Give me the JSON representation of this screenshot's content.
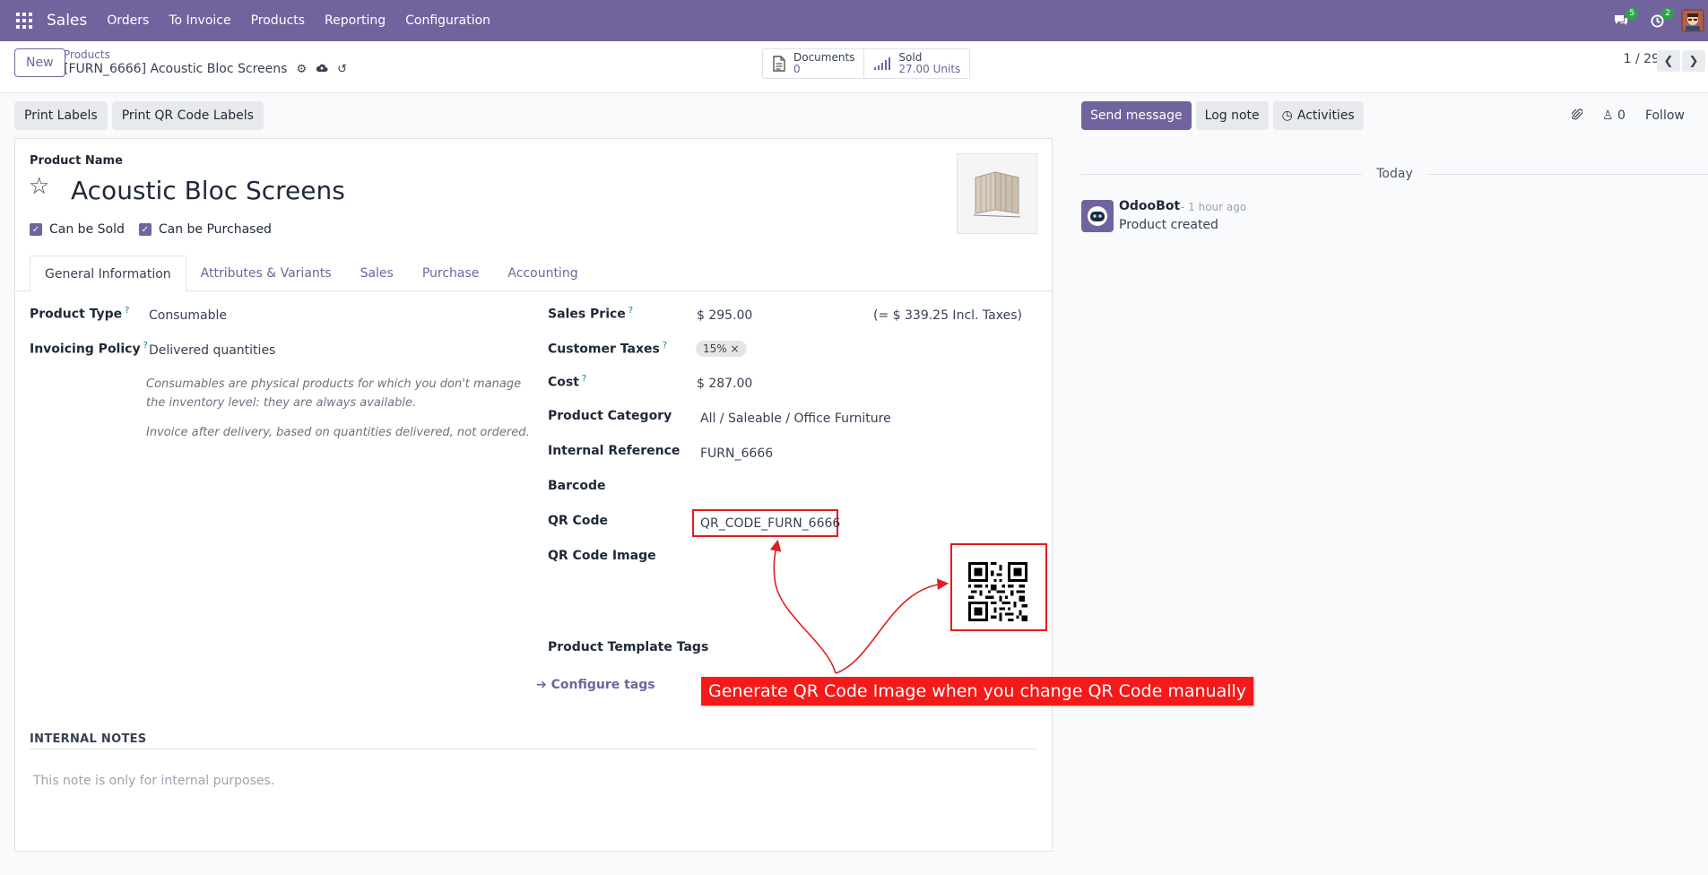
{
  "navbar": {
    "app_name": "Sales",
    "menu": [
      "Orders",
      "To Invoice",
      "Products",
      "Reporting",
      "Configuration"
    ],
    "messages_badge": "5",
    "activities_badge": "2"
  },
  "control_panel": {
    "new_label": "New",
    "breadcrumb_parent": "Products",
    "breadcrumb_current": "[FURN_6666] Acoustic Bloc Screens",
    "smart_buttons": {
      "documents_label": "Documents",
      "documents_value": "0",
      "sold_label": "Sold",
      "sold_value": "27.00 Units"
    },
    "pager": "1 / 29"
  },
  "actions": {
    "print_labels": "Print Labels",
    "print_qr_labels": "Print QR Code Labels"
  },
  "form": {
    "product_name_label": "Product Name",
    "product_name": "Acoustic Bloc Screens",
    "can_be_sold": "Can be Sold",
    "can_be_purchased": "Can be Purchased",
    "tabs": [
      "General Information",
      "Attributes & Variants",
      "Sales",
      "Purchase",
      "Accounting"
    ],
    "product_type_label": "Product Type",
    "product_type": "Consumable",
    "invoicing_policy_label": "Invoicing Policy",
    "invoicing_policy": "Delivered quantities",
    "help_consumable": "Consumables are physical products for which you don't manage the inventory level: they are always available.",
    "help_invoice": "Invoice after delivery, based on quantities delivered, not ordered.",
    "sales_price_label": "Sales Price",
    "sales_price": "$ 295.00",
    "incl_taxes": "(= $ 339.25 Incl. Taxes)",
    "customer_taxes_label": "Customer Taxes",
    "customer_tax_tag": "15%",
    "cost_label": "Cost",
    "cost": "$ 287.00",
    "product_category_label": "Product Category",
    "product_category": "All / Saleable / Office Furniture",
    "internal_reference_label": "Internal Reference",
    "internal_reference": "FURN_6666",
    "barcode_label": "Barcode",
    "qr_code_label": "QR Code",
    "qr_code": "QR_CODE_FURN_6666",
    "qr_code_image_label": "QR Code Image",
    "product_template_tags_label": "Product Template Tags",
    "configure_tags": "Configure tags",
    "internal_notes_label": "INTERNAL NOTES",
    "internal_notes_placeholder": "This note is only for internal purposes."
  },
  "annotation": {
    "callout": "Generate QR Code Image when you change QR Code manually",
    "color": "#f41a1a"
  },
  "chatter": {
    "send_message": "Send message",
    "log_note": "Log note",
    "activities": "Activities",
    "followers_count": "0",
    "follow": "Follow",
    "date_separator": "Today",
    "message": {
      "author": "OdooBot",
      "time": "- 1 hour ago",
      "body": "Product created"
    }
  },
  "colors": {
    "brand": "#71639e",
    "link": "#71639e",
    "highlight_red": "#e11d1d"
  }
}
